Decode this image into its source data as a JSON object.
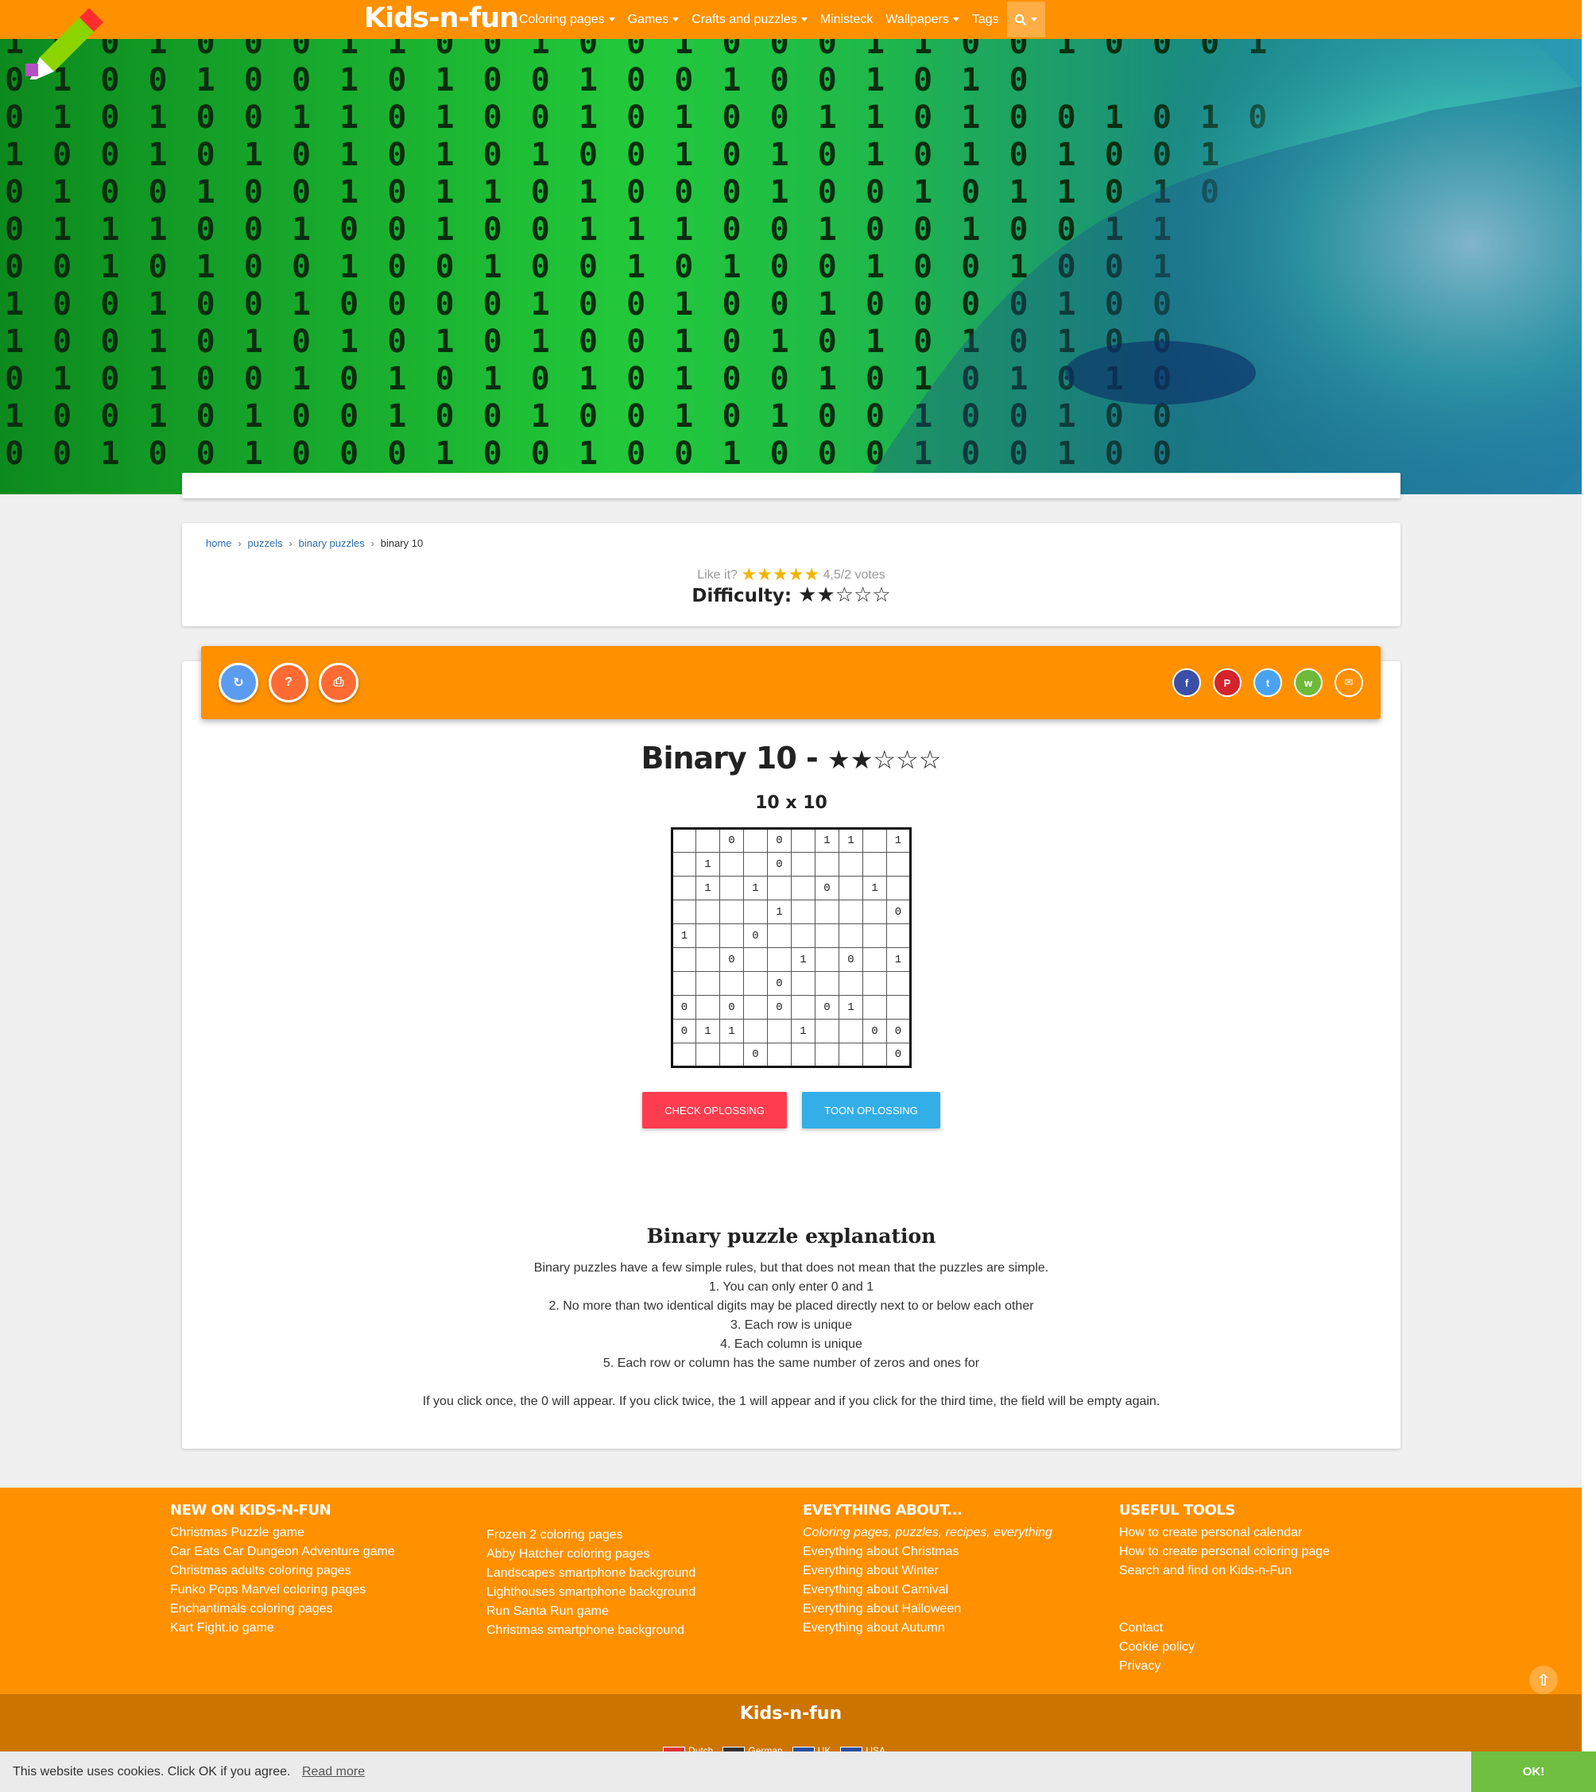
{
  "colors": {
    "brand_orange": "#ff9100",
    "footer_dark": "#cc7400",
    "check_button": "#ff3d4f",
    "show_button": "#33aee6",
    "cookie_ok": "#70bf41"
  },
  "nav": {
    "brand": "Kids-n-fun",
    "menu": [
      {
        "label": "Coloring pages",
        "dropdown": true
      },
      {
        "label": "Games",
        "dropdown": true
      },
      {
        "label": "Crafts and puzzles",
        "dropdown": true
      },
      {
        "label": "Ministeck",
        "dropdown": false
      },
      {
        "label": "Wallpapers",
        "dropdown": true
      },
      {
        "label": "Tags",
        "dropdown": false
      }
    ],
    "search_icon": "search-icon"
  },
  "hero": {
    "binary_rows": [
      "1 0 0 1 0 0 0 1 1 0 0 1 0 0 1 0 0 0 1 1 0 0 1 0 0 0 1",
      "0 1 0 0 1 0 0 1 0 1 0 0 1 0 0 1 0 0 1 0 1 0",
      "0 1 0 1 0 0 1 1 0 1 0 0 1 0 1 0 0 1 1 0 1 0 0 1 0 1 0",
      "1 0 0 1 0 1 0 1 0 1 0 1 0 0 1 0 1 0 1 0 1 0 1 0 0 1",
      "0 1 0 0 1 0 0 1 0 1 1 0 1 0 0 0 1 0 0 1 0 1 1 0 1 0",
      "0 1 1 1 0 0 1 0 0 1 0 0 1 1 1 0 0 1 0 0 1 0 0 1 1",
      "0 0 1 0 1 0 0 1 0 0 1 0 0 1 0 1 0 0 1 0 0 1 0 0 1",
      "1 0 0 1 0 0 1 0 0 0 0 1 0 0 1 0 0 1 0 0 0 0 1 0 0",
      "1 0 0 1 0 1 0 1 0 1 0 1 0 0 1 0 1 0 1 0 1 0 1 0 0",
      "0 1 0 1 0 0 1 0 1 0 1 0 1 0 1 0 0 1 0 1 0 1 0 1 0",
      "1 0 0 1 0 1 0 0 1 0 0 1 0 0 1 0 1 0 0 1 0 0 1 0 0",
      "0 0 1 0 0 1 0 0 0 1 0 0 1 0 0 1 0 0 0 1 0 0 1 0 0"
    ]
  },
  "breadcrumb": {
    "items": [
      "home",
      "puzzels",
      "binary puzzles"
    ],
    "current": "binary 10"
  },
  "rating": {
    "prefix": "Like it?",
    "stars": 5,
    "votes_text": "4,5/2 votes"
  },
  "difficulty": {
    "label": "Difficulty:",
    "filled": 2,
    "total": 5
  },
  "toolbar": {
    "buttons": [
      {
        "name": "refresh-button",
        "icon": "refresh-icon",
        "glyph": "↻",
        "color": "#5b9cf0"
      },
      {
        "name": "help-button",
        "icon": "question-icon",
        "glyph": "?",
        "color": "#ff6b33"
      },
      {
        "name": "print-button",
        "icon": "print-icon",
        "glyph": "⎙",
        "color": "#ff6b33"
      }
    ],
    "share": [
      {
        "name": "share-facebook-button",
        "icon": "facebook-icon",
        "glyph": "f",
        "color": "#3b4fa8"
      },
      {
        "name": "share-pinterest-button",
        "icon": "pinterest-icon",
        "glyph": "P",
        "color": "#d3232b"
      },
      {
        "name": "share-twitter-button",
        "icon": "twitter-icon",
        "glyph": "t",
        "color": "#4aa3ef"
      },
      {
        "name": "share-whatsapp-button",
        "icon": "whatsapp-icon",
        "glyph": "w",
        "color": "#6dba3b"
      },
      {
        "name": "share-email-button",
        "icon": "email-icon",
        "glyph": "✉",
        "color": "#ff9100"
      }
    ]
  },
  "puzzle": {
    "title": "Binary 10 -",
    "title_filled_stars": 2,
    "title_total_stars": 5,
    "size_label": "10 x 10",
    "grid": [
      [
        "",
        "",
        "0",
        "",
        "0",
        "",
        "1",
        "1",
        "",
        "1"
      ],
      [
        "",
        "1",
        "",
        "",
        "0",
        "",
        "",
        "",
        "",
        ""
      ],
      [
        "",
        "1",
        "",
        "1",
        "",
        "",
        "0",
        "",
        "1",
        ""
      ],
      [
        "",
        "",
        "",
        "",
        "1",
        "",
        "",
        "",
        "",
        "0"
      ],
      [
        "1",
        "",
        "",
        "0",
        "",
        "",
        "",
        "",
        "",
        ""
      ],
      [
        "",
        "",
        "0",
        "",
        "",
        "1",
        "",
        "0",
        "",
        "1"
      ],
      [
        "",
        "",
        "",
        "",
        "0",
        "",
        "",
        "",
        "",
        ""
      ],
      [
        "0",
        "",
        "0",
        "",
        "0",
        "",
        "0",
        "1",
        "",
        ""
      ],
      [
        "0",
        "1",
        "1",
        "",
        "",
        "1",
        "",
        "",
        "0",
        "0"
      ],
      [
        "",
        "",
        "",
        "0",
        "",
        "",
        "",
        "",
        "",
        "0"
      ]
    ],
    "check_label": "CHECK OPLOSSING",
    "show_label": "TOON OPLOSSING"
  },
  "explanation": {
    "title": "Binary puzzle explanation",
    "intro": "Binary puzzles have a few simple rules, but that does not mean that the puzzles are simple.",
    "rules": [
      "1. You can only enter 0 and 1",
      "2. No more than two identical digits may be placed directly next to or below each other",
      "3. Each row is unique",
      "4. Each column is unique",
      "5. Each row or column has the same number of zeros and ones for"
    ],
    "note": "If you click once, the 0 will appear. If you click twice, the 1 will appear and if you click for the third time, the field will be empty again."
  },
  "footer": {
    "col1": {
      "title": "NEW ON KIDS-N-FUN",
      "links": [
        "Christmas Puzzle game",
        "Car Eats Car Dungeon Adventure game",
        "Christmas adults coloring pages",
        "Funko Pops Marvel coloring pages",
        "Enchantimals coloring pages",
        "Kart Fight.io game"
      ]
    },
    "col2": {
      "links": [
        "Frozen 2 coloring pages",
        "Abby Hatcher coloring pages",
        "Landscapes smartphone background",
        "Lighthouses smartphone background",
        "Run Santa Run game",
        "Christmas smartphone background"
      ]
    },
    "col3": {
      "title": "EVEYTHING ABOUT...",
      "subtitle": "Coloring pages, puzzles, recipes, everything",
      "links": [
        "Everything about Christmas",
        "Everything about Winter",
        "Everything about Carnival",
        "Everything about Halloween",
        "Everything about Autumn"
      ]
    },
    "col4": {
      "title": "USEFUL TOOLS",
      "links": [
        "How to create personal calendar",
        "How to create personal coloring page",
        "Search and find on Kids-n-Fun"
      ],
      "links2": [
        "Contact",
        "Cookie policy",
        "Privacy"
      ]
    },
    "bottom_brand": "Kids-n-fun",
    "languages": [
      "Dutch",
      "German",
      "UK",
      "USA"
    ]
  },
  "cookie": {
    "text": "This website uses cookies. Click OK if you agree.",
    "more": "Read more",
    "ok": "OK!"
  }
}
